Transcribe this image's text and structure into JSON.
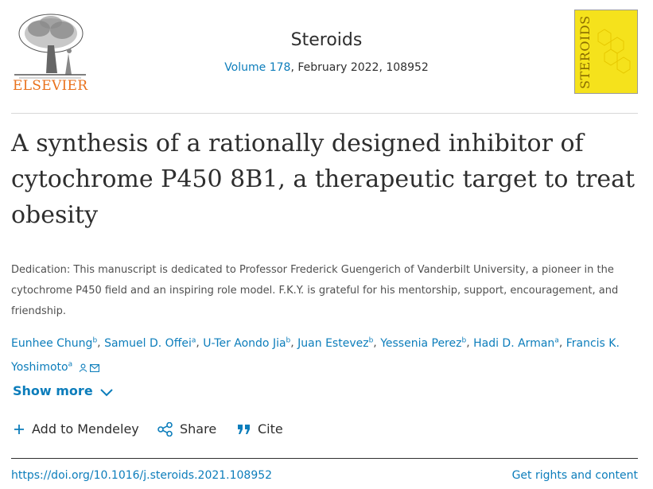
{
  "header": {
    "publisher_wordmark": "ELSEVIER",
    "journal_title": "Steroids",
    "volume_label": "Volume 178",
    "issue_rest": ", February 2022, 108952",
    "cover_text": "STEROIDS",
    "brand_orange": "#e9711c",
    "cover_yellow": "#f5e21c"
  },
  "article": {
    "title_line1": "A synthesis of a rationally designed inhibitor of",
    "title_line2": "cytochrome P450 8B1, a therapeutic target to treat",
    "title_line3": "obesity",
    "dedication": "Dedication: This manuscript is dedicated to Professor Frederick Guengerich of Vanderbilt University, a pioneer in the cytochrome P450 field and an inspiring role model. F.K.Y. is grateful for his mentorship, support, encouragement, and friendship."
  },
  "authors": [
    {
      "name": "Eunhee Chung",
      "sup": "b"
    },
    {
      "name": "Samuel D. Offei",
      "sup": "a"
    },
    {
      "name": "U-Ter Aondo Jia",
      "sup": "b"
    },
    {
      "name": "Juan Estevez",
      "sup": "b"
    },
    {
      "name": "Yessenia Perez",
      "sup": "b"
    },
    {
      "name": "Hadi D. Arman",
      "sup": "a"
    },
    {
      "name": "Francis K. Yoshimoto",
      "sup": "a"
    }
  ],
  "controls": {
    "show_more": "Show more",
    "add_to_mendeley": "Add to Mendeley",
    "share": "Share",
    "cite": "Cite"
  },
  "footer": {
    "doi": "https://doi.org/10.1016/j.steroids.2021.108952",
    "rights": "Get rights and content"
  },
  "colors": {
    "link": "#0c7dbb",
    "text": "#2e2e2e"
  }
}
